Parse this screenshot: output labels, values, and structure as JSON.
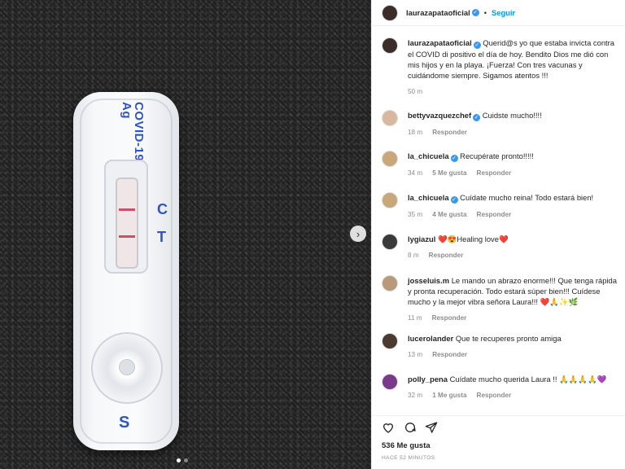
{
  "post": {
    "username": "laurazapataoficial",
    "follow_label": "Seguir",
    "caption": "Querid@s yo que estaba invicta contra el COVID di positivo el día de hoy. Bendito Dios me dió con mis hijos y en la playa. ¡Fuerza! Con tres vacunas y cuidándome siempre. Sigamos atentos !!!",
    "caption_time": "50 m",
    "likes": "536 Me gusta",
    "time_ago": "HACE 52 MINUTOS"
  },
  "photo": {
    "test_label": "COVID-19\nAg",
    "label_c": "C",
    "label_t": "T",
    "label_s": "S"
  },
  "reply_label": "Responder",
  "comments": [
    {
      "user": "bettyvazquezchef",
      "verified": true,
      "text": "Cuidste mucho!!!!",
      "time": "18 m",
      "likes": "",
      "avatar": "#d9b8a0"
    },
    {
      "user": "la_chicuela",
      "verified": true,
      "text": "Recupérate pronto!!!!!",
      "time": "34 m",
      "likes": "5 Me gusta",
      "avatar": "#c8a77a"
    },
    {
      "user": "la_chicuela",
      "verified": true,
      "text": "Cuídate mucho reina! Todo estará bien!",
      "time": "35 m",
      "likes": "4 Me gusta",
      "avatar": "#c8a77a"
    },
    {
      "user": "lygiazul",
      "verified": false,
      "text": "❤️😍Healing love❤️",
      "time": "8 m",
      "likes": "",
      "avatar": "#3a3a3a"
    },
    {
      "user": "josseluis.m",
      "verified": false,
      "text": "Le mando un abrazo enorme!!! Que tenga rápida y pronta recuperación. Todo estará súper bien!!! Cuídese mucho y la mejor vibra señora Laura!!! ❤️🙏✨🌿",
      "time": "11 m",
      "likes": "",
      "avatar": "#b89a7a"
    },
    {
      "user": "lucerolander",
      "verified": false,
      "text": "Que te recuperes pronto amiga",
      "time": "13 m",
      "likes": "",
      "avatar": "#4a3a30"
    },
    {
      "user": "polly_pena",
      "verified": false,
      "text": "Cuídate mucho querida Laura !! 🙏🙏🙏🙏💜",
      "time": "32 m",
      "likes": "1 Me gusta",
      "avatar": "#7a3a8a"
    }
  ],
  "colors": {
    "accent": "#0095f6",
    "verified": "#3897f0",
    "test_blue": "#2f55c0",
    "line_red": "#c8506a"
  },
  "icons": [
    "heart-icon",
    "comment-icon",
    "share-icon",
    "chevron-right-icon",
    "verified-icon"
  ]
}
